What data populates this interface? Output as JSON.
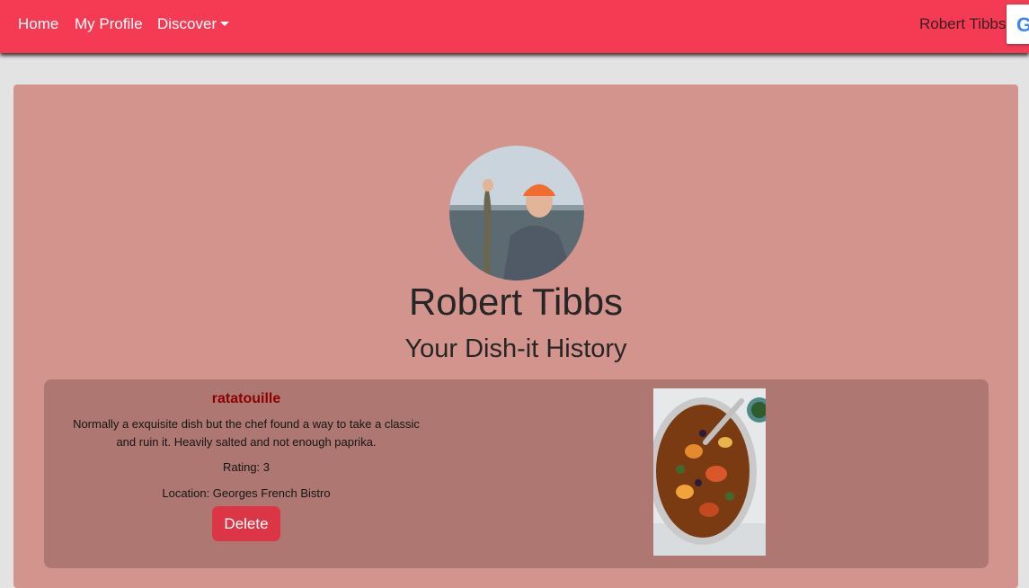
{
  "nav": {
    "home": "Home",
    "profile": "My Profile",
    "discover": "Discover",
    "user": "Robert Tibbs",
    "google": "G"
  },
  "profile": {
    "name": "Robert Tibbs",
    "history_title": "Your Dish-it History"
  },
  "history": [
    {
      "dish": "ratatouille",
      "description": "Normally a exquisite dish but the chef found a way to take a classic and ruin it. Heavily salted and not enough paprika.",
      "rating": "Rating: 3",
      "location": "Location: Georges French Bistro",
      "delete_label": "Delete"
    }
  ],
  "colors": {
    "navbar": "#f53b54",
    "panel": "#d4948e",
    "card": "#ae7772",
    "dish_title": "#8b0000",
    "delete": "#dc3545"
  }
}
